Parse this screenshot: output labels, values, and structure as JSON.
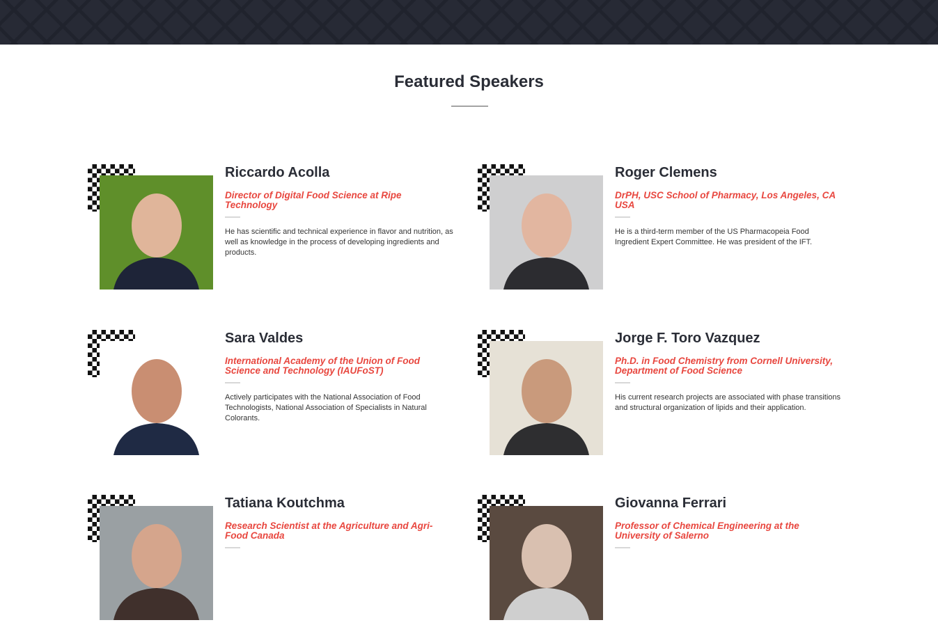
{
  "section": {
    "title": "Featured Speakers"
  },
  "colors": {
    "accent": "#e8473f",
    "header_bg": "#272a35",
    "text": "#2a2d36"
  },
  "speakers": [
    {
      "name": "Riccardo Acolla",
      "role": "Director of Digital Food Science at Ripe Technology",
      "bio": "He has scientific and technical experience in flavor and nutrition, as well as knowledge in the process of developing ingredients and products."
    },
    {
      "name": "Roger Clemens",
      "role": "DrPH, USC School of Pharmacy, Los Angeles, CA USA",
      "bio": "He is a third-term member of the US Pharmacopeia Food Ingredient Expert Committee. He was president of the IFT."
    },
    {
      "name": "Sara Valdes",
      "role": "International Academy of the Union of Food Science and Technology (IAUFoST)",
      "bio": "Actively participates with the National Association of Food Technologists, National Association of Specialists in Natural Colorants."
    },
    {
      "name": "Jorge F. Toro Vazquez",
      "role": "Ph.D. in Food Chemistry from Cornell University, Department of Food Science",
      "bio": "His current research projects are associated with phase transitions and structural organization of lipids and their application."
    },
    {
      "name": "Tatiana Koutchma",
      "role": "Research Scientist at the Agriculture and Agri-Food Canada",
      "bio": ""
    },
    {
      "name": "Giovanna Ferrari",
      "role": "Professor of Chemical Engineering at the University of Salerno",
      "bio": ""
    }
  ]
}
